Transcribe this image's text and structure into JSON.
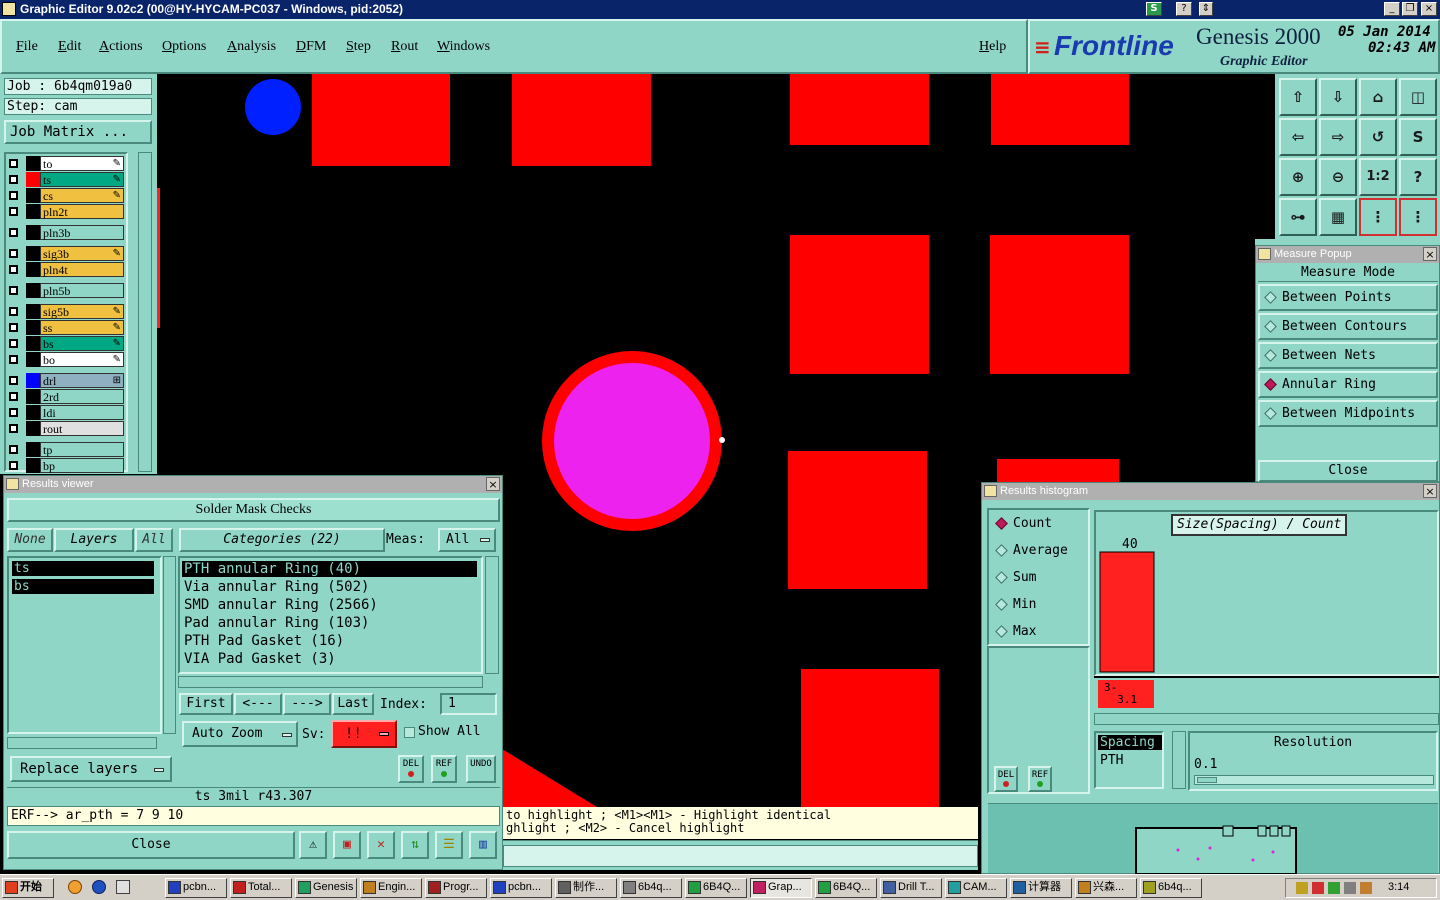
{
  "window": {
    "title": "Graphic Editor 9.02c2 (00@HY-HYCAM-PC037 - Windows, pid:2052)"
  },
  "menu": [
    "File",
    "Edit",
    "Actions",
    "Options",
    "Analysis",
    "DFM",
    "Step",
    "Rout",
    "Windows"
  ],
  "help_label": "Help",
  "brand": {
    "logo": "Frontline",
    "product": "Genesis 2000",
    "subtitle": "Graphic Editor",
    "date": "05 Jan 2014",
    "time": "02:43 AM"
  },
  "job": {
    "job_line": "Job : 6b4qm019a0",
    "step_line": "Step: cam",
    "matrix_button": "Job Matrix ..."
  },
  "layers": [
    {
      "name": "to",
      "color": "#ffffff",
      "swatch": "#000000",
      "mark": "✎"
    },
    {
      "name": "ts",
      "color": "#00a884",
      "swatch": "#ff0000",
      "mark": "✎"
    },
    {
      "name": "cs",
      "color": "#f0c040",
      "swatch": "#000000",
      "mark": "✎"
    },
    {
      "name": "pln2t",
      "color": "#f0c040",
      "swatch": "#000000",
      "mark": ""
    },
    {
      "name": "pln3b",
      "color": "#8fd6c6",
      "swatch": "#000000",
      "mark": ""
    },
    {
      "name": "sig3b",
      "color": "#f0c040",
      "swatch": "#000000",
      "mark": "✎"
    },
    {
      "name": "pln4t",
      "color": "#f0c040",
      "swatch": "#000000",
      "mark": ""
    },
    {
      "name": "pln5b",
      "color": "#8fd6c6",
      "swatch": "#000000",
      "mark": ""
    },
    {
      "name": "sig5b",
      "color": "#f0c040",
      "swatch": "#000000",
      "mark": "✎"
    },
    {
      "name": "ss",
      "color": "#f0c040",
      "swatch": "#000000",
      "mark": "✎"
    },
    {
      "name": "bs",
      "color": "#00a884",
      "swatch": "#000000",
      "mark": "✎"
    },
    {
      "name": "bo",
      "color": "#ffffff",
      "swatch": "#000000",
      "mark": "✎"
    },
    {
      "name": "drl",
      "color": "#8fb0c0",
      "swatch": "#0000ff",
      "mark": "⊞"
    },
    {
      "name": "2rd",
      "color": "#8fd6c6",
      "swatch": "#000000",
      "mark": ""
    },
    {
      "name": "ldi",
      "color": "#8fd6c6",
      "swatch": "#000000",
      "mark": ""
    },
    {
      "name": "rout",
      "color": "#e0e0e0",
      "swatch": "#000000",
      "mark": ""
    },
    {
      "name": "tp",
      "color": "#8fd6c6",
      "swatch": "#000000",
      "mark": ""
    },
    {
      "name": "bp",
      "color": "#8fd6c6",
      "swatch": "#000000",
      "mark": ""
    }
  ],
  "measure_popup": {
    "title": "Measure Popup",
    "header": "Measure Mode",
    "options": [
      "Between Points",
      "Between Contours",
      "Between Nets",
      "Annular Ring",
      "Between Midpoints"
    ],
    "selected": "Annular Ring",
    "close": "Close"
  },
  "results_viewer": {
    "title": "Results viewer",
    "header": "Solder Mask Checks",
    "none_btn": "None",
    "layers_btn": "Layers",
    "all_btn": "All",
    "categories_btn": "Categories (22)",
    "meas_label": "Meas:",
    "meas_value": "All",
    "layer_list": [
      "ts",
      "bs"
    ],
    "categories": [
      "PTH annular Ring (40)",
      "Via annular Ring (502)",
      "SMD annular Ring (2566)",
      "Pad annular Ring (103)",
      "PTH Pad Gasket (16)",
      "VIA Pad Gasket (3)"
    ],
    "first_btn": "First",
    "prev_btn": "<---",
    "next_btn": "--->",
    "last_btn": "Last",
    "index_label": "Index:",
    "index_value": "1",
    "autozoom": "Auto Zoom",
    "sv_label": "Sv:",
    "sv_value": "!!",
    "show_all": "Show All",
    "replace_layers": "Replace layers",
    "del_label": "DEL",
    "ref_label": "REF",
    "undo_label": "UNDO",
    "status": "ts 3mil r43.307",
    "erf_line": "ERF--> ar_pth = 7 9 10",
    "close": "Close"
  },
  "hint": {
    "line1": "to highlight ; <M1><M1> - Highlight identical",
    "line2": "ghlight ; <M2> - Cancel highlight"
  },
  "histogram": {
    "title": "Results histogram",
    "modes": [
      "Count",
      "Average",
      "Sum",
      "Min",
      "Max"
    ],
    "selected": "Count",
    "chart_title": "Size(Spacing) / Count",
    "del_label": "DEL",
    "ref_label": "REF",
    "list": [
      "Spacing",
      "PTH"
    ],
    "resolution_label": "Resolution",
    "resolution_value": "0.1"
  },
  "chart_data": {
    "type": "bar",
    "title": "Size(Spacing) / Count",
    "categories": [
      "3-3.1"
    ],
    "category_label": "3-\n  3.1",
    "values": [
      40
    ],
    "value_label": "40",
    "bar_color": "#ff2020"
  },
  "taskbar": {
    "start": "开始",
    "tasks": [
      "pcbn...",
      "Total...",
      "Genesis",
      "Engin...",
      "Progr...",
      "pcbn...",
      "制作...",
      "6b4q...",
      "6B4Q...",
      "Grap...",
      "6B4Q...",
      "Drill T...",
      "CAM...",
      "计算器",
      "兴森...",
      "6b4q..."
    ],
    "clock": "3:14"
  }
}
